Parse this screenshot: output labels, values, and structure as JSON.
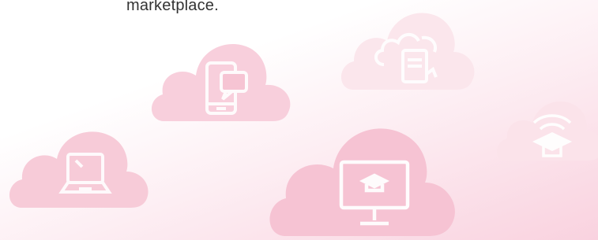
{
  "caption": "marketplace.",
  "colors": {
    "cloud_strong": "#f6c3d3",
    "cloud_light": "#fbe3ea",
    "icon_line": "#ffffff"
  },
  "clouds": [
    {
      "icon": "smartphone-chat-icon"
    },
    {
      "icon": "cloud-sync-document-icon"
    },
    {
      "icon": "wifi-graduation-cap-icon"
    },
    {
      "icon": "laptop-icon"
    },
    {
      "icon": "monitor-graduation-cap-icon"
    }
  ]
}
